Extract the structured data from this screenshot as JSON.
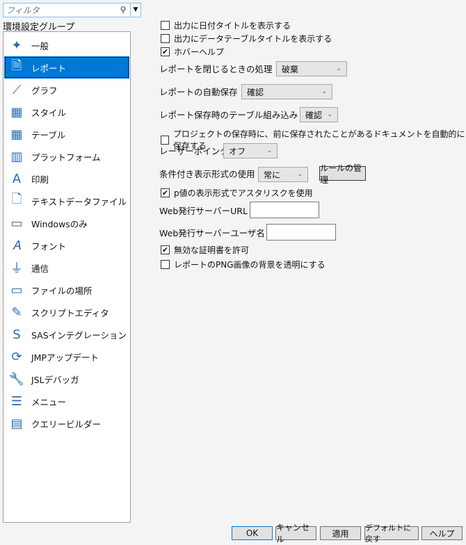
{
  "filter": {
    "placeholder": "フィルタ"
  },
  "group_label": "環境設定グループ",
  "groups": [
    {
      "label": "一般",
      "icon": "general-icon"
    },
    {
      "label": "レポート",
      "icon": "report-icon",
      "selected": true
    },
    {
      "label": "グラフ",
      "icon": "graph-icon"
    },
    {
      "label": "スタイル",
      "icon": "style-icon"
    },
    {
      "label": "テーブル",
      "icon": "table-icon"
    },
    {
      "label": "プラットフォーム",
      "icon": "platform-icon"
    },
    {
      "label": "印刷",
      "icon": "print-icon"
    },
    {
      "label": "テキストデータファイル",
      "icon": "text-file-icon"
    },
    {
      "label": "Windowsのみ",
      "icon": "monitor-icon"
    },
    {
      "label": "フォント",
      "icon": "font-icon"
    },
    {
      "label": "通信",
      "icon": "communication-icon"
    },
    {
      "label": "ファイルの場所",
      "icon": "folder-icon"
    },
    {
      "label": "スクリプトエディタ",
      "icon": "script-editor-icon"
    },
    {
      "label": "SASインテグレーション",
      "icon": "sas-icon"
    },
    {
      "label": "JMPアップデート",
      "icon": "update-icon"
    },
    {
      "label": "JSLデバッガ",
      "icon": "wrench-icon"
    },
    {
      "label": "メニュー",
      "icon": "menu-icon"
    },
    {
      "label": "クエリービルダー",
      "icon": "query-builder-icon"
    }
  ],
  "settings": {
    "cb_date_title": {
      "label": "出力に日付タイトルを表示する",
      "checked": false
    },
    "cb_table_title": {
      "label": "出力にデータテーブルタイトルを表示する",
      "checked": false
    },
    "cb_hover_help": {
      "label": "ホバーヘルプ",
      "checked": true
    },
    "close_action": {
      "label": "レポートを閉じるときの処理",
      "value": "破棄"
    },
    "autosave": {
      "label": "レポートの自動保存",
      "value": "確認"
    },
    "embed_table": {
      "label": "レポート保存時のテーブル組み込み",
      "value": "確認"
    },
    "cb_project_save": {
      "label": "プロジェクトの保存時に、前に保存されたことがあるドキュメントを自動的に保存する",
      "checked": false
    },
    "laser": {
      "label": "レーザーポインタ",
      "value": "オフ"
    },
    "conditional": {
      "label": "条件付き表示形式の使用",
      "value": "常に",
      "button": "ルールの管理"
    },
    "cb_pvalue": {
      "label": "p値の表示形式でアスタリスクを使用",
      "checked": true
    },
    "web_url": {
      "label": "Web発行サーバーURL",
      "value": ""
    },
    "web_user": {
      "label": "Web発行サーバーユーザ名",
      "value": ""
    },
    "cb_invalid_cert": {
      "label": "無効な証明書を許可",
      "checked": true
    },
    "cb_png_transparent": {
      "label": "レポートのPNG画像の背景を透明にする",
      "checked": false
    }
  },
  "buttons": {
    "ok": "OK",
    "cancel": "キャンセル",
    "apply": "適用",
    "default": "デフォルトに戻す",
    "help": "ヘルプ"
  },
  "check_glyph": "✔"
}
